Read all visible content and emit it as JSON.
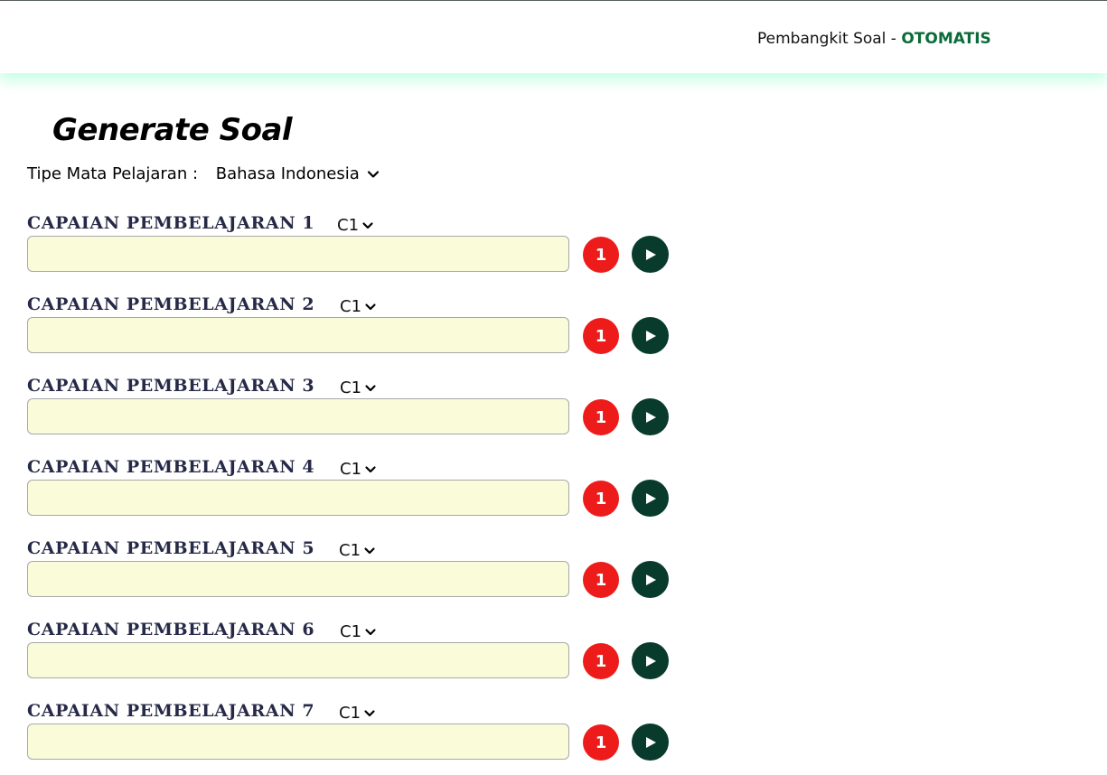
{
  "navbar": {
    "brand_prefix": "Pembangkit Soal - ",
    "brand_accent": "OTOMATIS"
  },
  "page": {
    "title": "Generate Soal"
  },
  "subject": {
    "label": "Tipe Mata Pelajaran :",
    "selected": "Bahasa Indonesia"
  },
  "capaian": [
    {
      "label": "CAPAIAN PEMBELAJARAN 1",
      "level": "C1",
      "value": "",
      "count": "1"
    },
    {
      "label": "CAPAIAN PEMBELAJARAN 2",
      "level": "C1",
      "value": "",
      "count": "1"
    },
    {
      "label": "CAPAIAN PEMBELAJARAN 3",
      "level": "C1",
      "value": "",
      "count": "1"
    },
    {
      "label": "CAPAIAN PEMBELAJARAN 4",
      "level": "C1",
      "value": "",
      "count": "1"
    },
    {
      "label": "CAPAIAN PEMBELAJARAN 5",
      "level": "C1",
      "value": "",
      "count": "1"
    },
    {
      "label": "CAPAIAN PEMBELAJARAN 6",
      "level": "C1",
      "value": "",
      "count": "1"
    },
    {
      "label": "CAPAIAN PEMBELAJARAN 7",
      "level": "C1",
      "value": "",
      "count": "1"
    }
  ],
  "icons": {
    "level_dropdown": "chevron-down-icon",
    "submit": "play-icon"
  },
  "colors": {
    "accent": "#0b6b3a",
    "count_badge": "#ee1b1b",
    "go_button": "#083b2c",
    "input_bg": "#fafbd8",
    "label": "#262a47"
  }
}
